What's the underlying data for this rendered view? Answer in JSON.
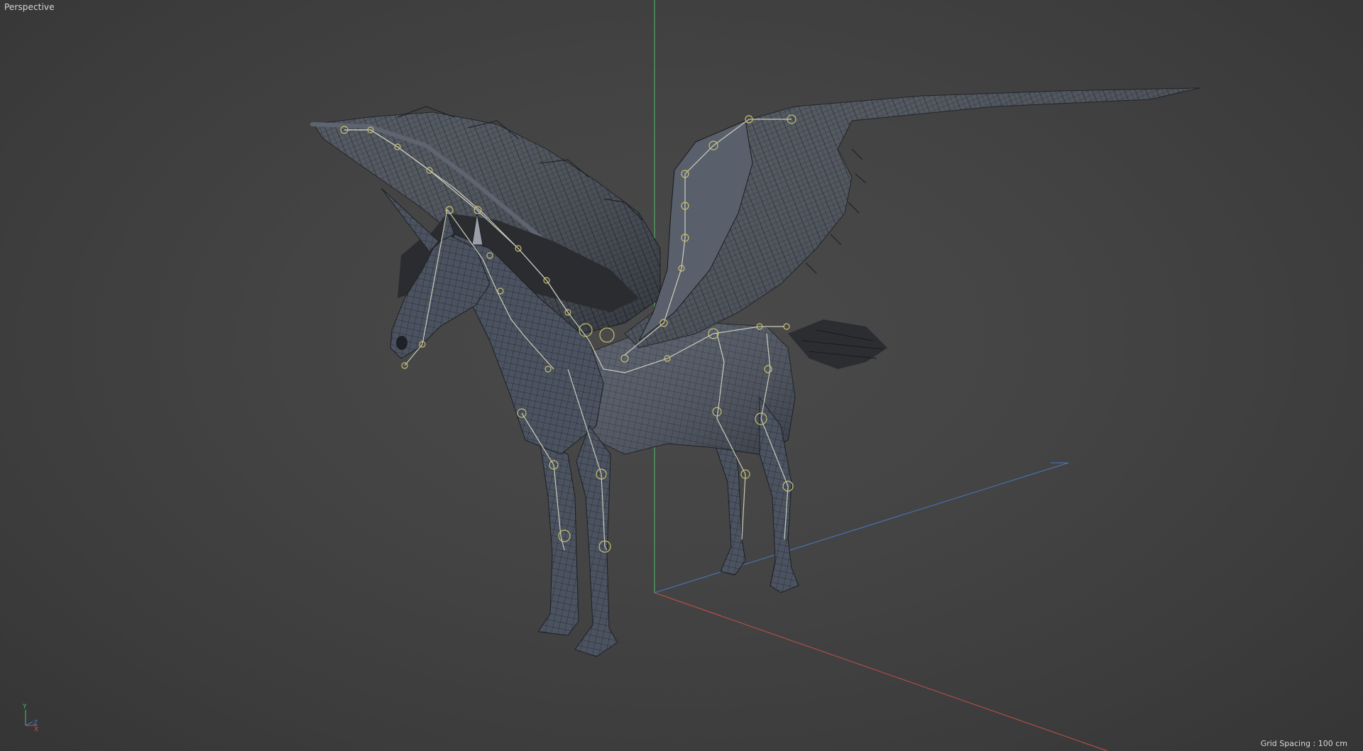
{
  "viewport": {
    "view_name": "Perspective",
    "grid_spacing_label": "Grid Spacing : 100 cm"
  },
  "axis_gizmo": {
    "y_label": "Y",
    "z_label": "Z",
    "x_label": "X"
  },
  "colors": {
    "background": "#444444",
    "axis_x": "#c8504a",
    "axis_y": "#4dbb6a",
    "axis_z": "#4a78c0",
    "joint": "#c8c070",
    "mesh_fill": "#4c5360",
    "wire": "#1c1f24"
  },
  "icons": {
    "axis_gizmo": "xyz-axis-icon"
  }
}
